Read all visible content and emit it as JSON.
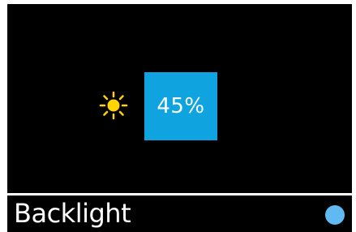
{
  "screen": {
    "background": "#000000",
    "brightness": {
      "icon": "sun-icon",
      "icon_color": "#ffd400",
      "value_text": "45%",
      "value_box_color": "#0fa3e0"
    },
    "footer": {
      "label": "Backlight",
      "indicator_color": "#61b9f2"
    }
  }
}
